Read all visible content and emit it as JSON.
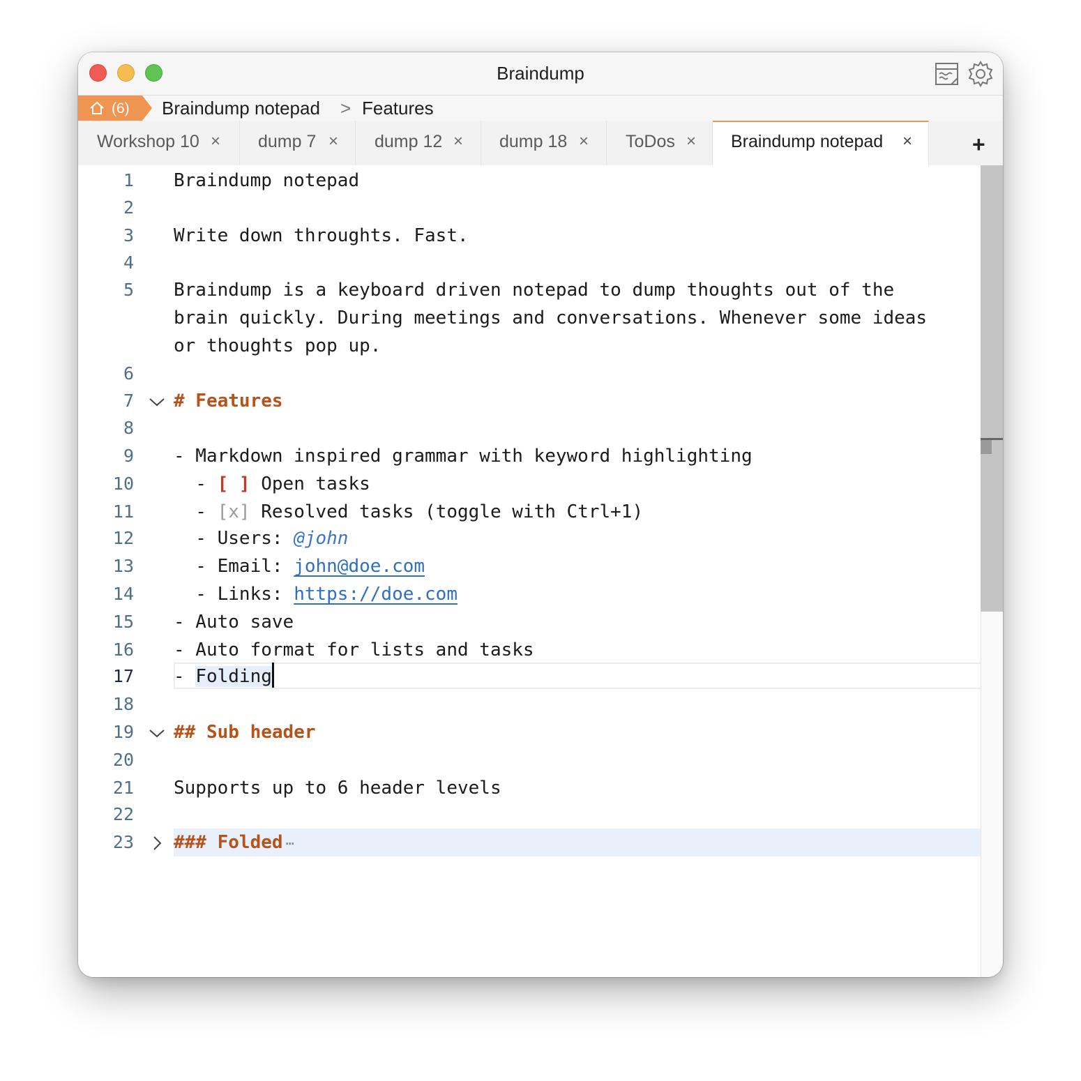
{
  "window": {
    "title": "Braindump"
  },
  "titlebar_icons": {
    "notes": "notes-icon",
    "settings": "gear-icon"
  },
  "breadcrumb": {
    "home_count": "(6)",
    "items": [
      "Braindump notepad",
      "Features"
    ],
    "separator": ">"
  },
  "tabs": [
    {
      "label": "Workshop 10",
      "close": "×",
      "active": false
    },
    {
      "label": "dump 7",
      "close": "×",
      "active": false
    },
    {
      "label": "dump 12",
      "close": "×",
      "active": false
    },
    {
      "label": "dump 18",
      "close": "×",
      "active": false
    },
    {
      "label": "ToDos",
      "close": "×",
      "active": false
    },
    {
      "label": "Braindump notepad",
      "close": "×",
      "active": true
    }
  ],
  "tab_add": "+",
  "editor": {
    "current_line": 17,
    "lines": {
      "n1": "1",
      "n2": "2",
      "n3": "3",
      "n4": "4",
      "n5": "5",
      "n6": "6",
      "n7": "7",
      "n8": "8",
      "n9": "9",
      "n10": "10",
      "n11": "11",
      "n12": "12",
      "n13": "13",
      "n14": "14",
      "n15": "15",
      "n16": "16",
      "n17": "17",
      "n18": "18",
      "n19": "19",
      "n20": "20",
      "n21": "21",
      "n22": "22",
      "n23": "23",
      "l1": "Braindump notepad",
      "l3": "Write down throughts. Fast.",
      "l5a": "Braindump is a keyboard driven notepad to dump thoughts out of the",
      "l5b": "brain quickly. During meetings and conversations. Whenever some ideas",
      "l5c": "or thoughts pop up.",
      "l7": "# Features",
      "l9": "- Markdown inspired grammar with keyword highlighting",
      "l10_dash": "  - ",
      "l10_box": "[ ]",
      "l10_text": " Open tasks",
      "l11_dash": "  - ",
      "l11_box": "[x]",
      "l11_text": " Resolved tasks (toggle with Ctrl+1)",
      "l12_pre": "  - Users: ",
      "l12_user": "@john",
      "l13_pre": "  - Email: ",
      "l13_link": "john@doe.com",
      "l14_pre": "  - Links: ",
      "l14_link": "https://doe.com",
      "l15": "- Auto save",
      "l16": "- Auto format for lists and tasks",
      "l17_dash": "- ",
      "l17_word": "Folding",
      "l19": "## Sub header",
      "l21": "Supports up to 6 header levels",
      "l23": "### Folded",
      "l23_ellipsis": "⋯"
    }
  },
  "colors": {
    "accent": "#ef9451",
    "header": "#b5531b",
    "open_task": "#c0392b",
    "link": "#2f6fc2"
  }
}
